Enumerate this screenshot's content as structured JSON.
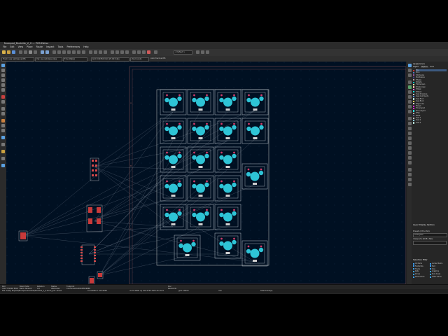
{
  "window": {
    "title": "Numpad_Ducktile_V_0 — PCB Editor"
  },
  "menu": [
    "File",
    "Edit",
    "View",
    "Place",
    "Route",
    "Inspect",
    "Tools",
    "Preferences",
    "Help"
  ],
  "toolbar": {
    "track_field": "Track: use netclass width",
    "via_field": "Via: use netclass sizes",
    "layer_field": "F.Cu (PgUp)",
    "grid_field": "Grid: 0.6350 mm (25.00 mils)",
    "zoom_field": "Zoom Auto",
    "highlight": "Auto track width",
    "preset": "• Default •"
  },
  "panel": {
    "appearance_title": "Appearance",
    "tabs": [
      "Layers",
      "Objects",
      "Nets"
    ],
    "layers": [
      {
        "name": "F.Cu",
        "color": "#c83434"
      },
      {
        "name": "B.Cu",
        "color": "#4d7fc4"
      },
      {
        "name": "F.Adhesive",
        "color": "#8a4d8a"
      },
      {
        "name": "B.Adhesive",
        "color": "#404080"
      },
      {
        "name": "F.Paste",
        "color": "#b4a0a0"
      },
      {
        "name": "B.Paste",
        "color": "#00c2c2"
      },
      {
        "name": "F.Silkscreen",
        "color": "#f2eda1"
      },
      {
        "name": "B.Silkscreen",
        "color": "#e8b2a7"
      },
      {
        "name": "F.Mask",
        "color": "#d864ff"
      },
      {
        "name": "B.Mask",
        "color": "#02ffee"
      },
      {
        "name": "User.Drawings",
        "color": "#c2c2c2"
      },
      {
        "name": "User.Comments",
        "color": "#5994dc"
      },
      {
        "name": "User.Eco1",
        "color": "#b4db d2"
      },
      {
        "name": "User.Eco2",
        "color": "#d8c852"
      },
      {
        "name": "Edge.Cuts",
        "color": "#d0d2cd"
      },
      {
        "name": "Margin",
        "color": "#ff26e2"
      },
      {
        "name": "F.Courtyard",
        "color": "#ff26e2"
      },
      {
        "name": "B.Courtyard",
        "color": "#26e9ff"
      },
      {
        "name": "F.Fab",
        "color": "#afafaf"
      },
      {
        "name": "B.Fab",
        "color": "#585d84"
      },
      {
        "name": "User.1",
        "color": "#c2c2c2"
      },
      {
        "name": "User.2",
        "color": "#89cbe3"
      },
      {
        "name": "User.3",
        "color": "#b4db d2"
      }
    ],
    "layer_display_title": "Layer Display Options",
    "presets_label": "Presets (Ctrl+Tab):",
    "preset_value": "All Layers",
    "viewports_label": "Viewports (Shift+Tab):",
    "viewport_value": "",
    "selection_filter_title": "Selection Filter",
    "selection_filter": [
      [
        "All items",
        "Locked items"
      ],
      [
        "Footprints",
        "Text"
      ],
      [
        "Tracks",
        "Vias"
      ],
      [
        "Pads",
        "Graphics"
      ],
      [
        "Zones",
        "Rule Areas"
      ],
      [
        "Dimensions",
        "Other items"
      ]
    ]
  },
  "status": {
    "cells": [
      {
        "k": "Pad",
        "v": "3/3/77 56/94 8/96"
      },
      {
        "k": "Board Side",
        "v": "Back (flipped)"
      },
      {
        "k": "Rotation",
        "v": "0.0"
      },
      {
        "k": "Status",
        "v": "Attributes"
      },
      {
        "k": "Footprint",
        "v": "Components:SOLDER/KEEP"
      },
      {
        "k": "3D-Shape",
        "v": "${KICAD7_3DMODEL_DIR}/Switch_Keyboard.3dshapes/SW_MX.wrl"
      },
      {
        "k": "Doc",
        "v": "Keywords"
      }
    ],
    "file": "File 'D:/My Projects/Numpad Ducktile/Ducktile_V_0.kicad_pcb' saved",
    "coords": "X 94.9000  Y 100.9000",
    "delta": "dx 76.0000  dy 100.3750  dist 125.1573",
    "grid": "grid 0.6350",
    "units": "mm",
    "mode": "Select item(s)"
  }
}
